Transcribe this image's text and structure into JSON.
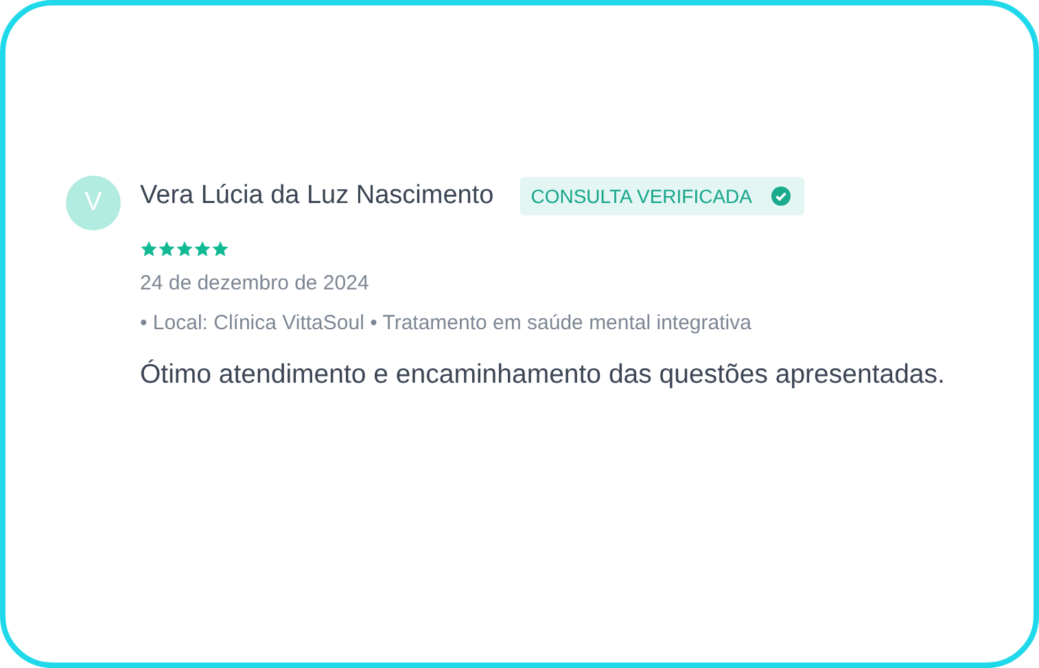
{
  "review": {
    "avatar_initial": "V",
    "author": "Vera Lúcia da Luz Nascimento",
    "badge": {
      "label": "CONSULTA VERIFICADA",
      "verified": true
    },
    "stars": 5,
    "date": "24 de dezembro de 2024",
    "details": "• Local: Clínica VittaSoul • Tratamento em saúde mental integrativa",
    "text": "Ótimo atendimento e encaminhamento das questões apresentadas."
  }
}
